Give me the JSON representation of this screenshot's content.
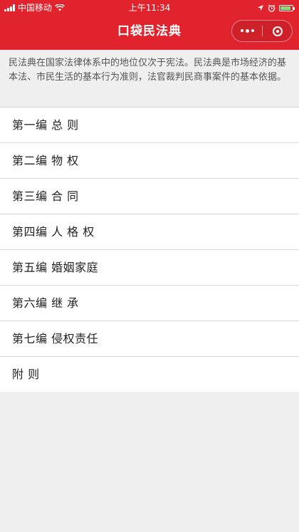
{
  "status_bar": {
    "carrier": "中国移动",
    "time": "上午11:34"
  },
  "header": {
    "title": "口袋民法典"
  },
  "intro": {
    "text": "民法典在国家法律体系中的地位仅次于宪法。民法典是市场经济的基本法、市民生活的基本行为准则，法官裁判民商事案件的基本依据。"
  },
  "sections": [
    {
      "label": "第一编  总 则"
    },
    {
      "label": "第二编  物 权"
    },
    {
      "label": "第三编  合 同"
    },
    {
      "label": "第四编  人 格 权"
    },
    {
      "label": "第五编  婚姻家庭"
    },
    {
      "label": "第六编  继 承"
    },
    {
      "label": "第七编  侵权责任"
    },
    {
      "label": "附 则"
    }
  ],
  "colors": {
    "brand": "#e0232c",
    "background": "#efefef",
    "battery": "#7ee07e"
  },
  "icons": [
    "signal-icon",
    "wifi-icon",
    "location-icon",
    "alarm-icon",
    "battery-icon",
    "more-icon",
    "close-mini-program-icon"
  ]
}
